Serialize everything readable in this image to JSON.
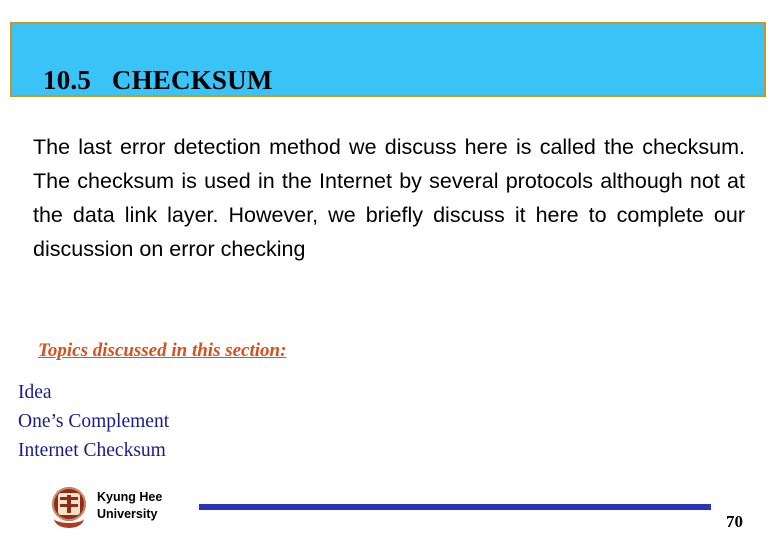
{
  "slide": {
    "title": "10.5   CHECKSUM",
    "body_paragraph": "The last error detection method we discuss here is called the checksum. The checksum is used in the Internet by several protocols although not at the data link layer. However, we briefly discuss it here to complete our discussion on error checking",
    "topics_heading": "Topics discussed in this section:",
    "topics": [
      "Idea",
      "One’s Complement",
      "Internet Checksum"
    ],
    "footer": {
      "logo_icon": "kyung-hee-university-seal-icon",
      "university_line1": "Kyung Hee",
      "university_line2": "University",
      "page_number": "70"
    },
    "colors": {
      "title_banner_fill": "#39c3f7",
      "title_banner_border": "#c79a1f",
      "topics_heading": "#d94f1a",
      "topics_text": "#1a1a8c",
      "footer_rule": "#2a35b5",
      "background": "#ffffff"
    }
  }
}
